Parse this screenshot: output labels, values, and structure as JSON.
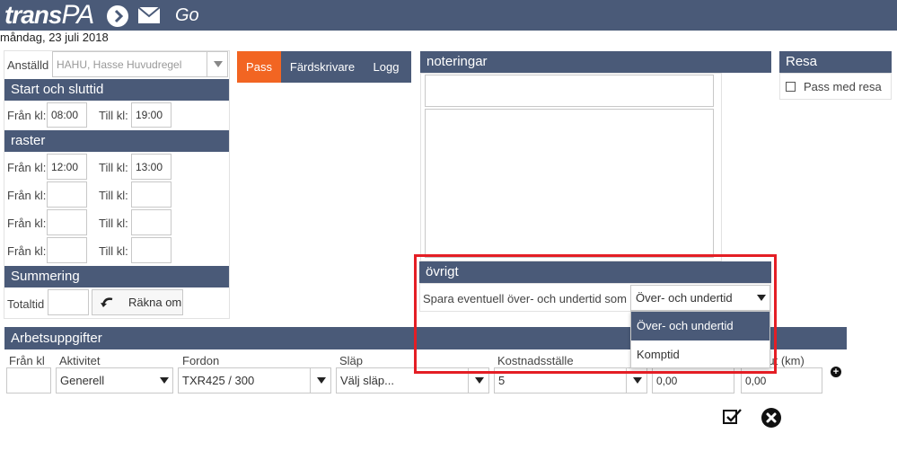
{
  "header": {
    "logo_main": "trans",
    "logo_suffix": "PA",
    "go_label": "Go",
    "date": "måndag, 23 juli 2018",
    "icons": [
      "arrow-right-circle-icon",
      "mail-icon"
    ]
  },
  "employee": {
    "label": "Anställd",
    "value": "HAHU, Hasse Huvudregel"
  },
  "shift": {
    "title": "Start och sluttid",
    "from_label": "Från kl:",
    "to_label": "Till kl:",
    "from": "08:00",
    "to": "19:00"
  },
  "breaks": {
    "title": "raster",
    "from_label": "Från kl:",
    "to_label": "Till kl:",
    "rows": [
      {
        "from": "12:00",
        "to": "13:00"
      },
      {
        "from": "",
        "to": ""
      },
      {
        "from": "",
        "to": ""
      },
      {
        "from": "",
        "to": ""
      }
    ]
  },
  "summary": {
    "title": "Summering",
    "total_label": "Totaltid",
    "total_value": "",
    "recalc_label": "Räkna om"
  },
  "tabs": [
    "Pass",
    "Färdskrivare",
    "Logg"
  ],
  "notes": {
    "title": "noteringar",
    "line1": "",
    "body": ""
  },
  "trip": {
    "title": "Resa",
    "checkbox_label": "Pass med resa",
    "checked": false
  },
  "other": {
    "title": "övrigt",
    "prompt": "Spara eventuell över- och undertid som",
    "selected": "Över- och undertid",
    "options": [
      "Över- och undertid",
      "Komptid"
    ]
  },
  "tasks": {
    "title": "Arbetsuppgifter",
    "columns": [
      "Från kl",
      "Aktivitet",
      "Fordon",
      "Släp",
      "Kostnadsställe",
      "",
      "slut (km)"
    ],
    "row": {
      "from": "",
      "activity": "Generell",
      "vehicle": "TXR425 / 300",
      "trailer": "Välj släp...",
      "cost_center": "5",
      "km_start": "0,00",
      "km_end": "0,00"
    }
  },
  "footer": {
    "icons": [
      "save-check-icon",
      "close-circle-icon"
    ]
  },
  "colors": {
    "header": "#4a5a78",
    "active_tab": "#f26522",
    "highlight": "#e41e25"
  }
}
